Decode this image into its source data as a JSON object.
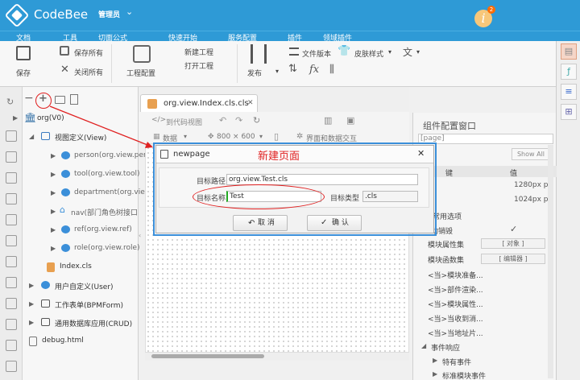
{
  "app": {
    "title": "CodeBee",
    "user": "管理员",
    "badge": "2"
  },
  "menu": [
    "文档",
    "工具",
    "切面公式",
    "快速开始",
    "服务配置",
    "插件",
    "领域插件"
  ],
  "ribbon": {
    "save": "保存",
    "save_all": "保存所有",
    "close_all": "关闭所有",
    "project_config": "工程配置",
    "new_project": "新建工程",
    "open_project": "打开工程",
    "publish": "发布",
    "file_version": "文件版本",
    "skin": "皮肤样式"
  },
  "tree": {
    "root": "org(V0)",
    "view_def": "视图定义(View)",
    "items": [
      "person(org.view.per",
      "tool(org.view.tool)",
      "department(org.vie",
      "nav(部门角色树接口",
      "ref(org.view.ref)",
      "role(org.view.role)"
    ],
    "index_file": "Index.cls",
    "user_def": "用户自定义(User)",
    "bpm_form": "工作表单(BPMForm)",
    "crud": "通用数据库应用(CRUD)",
    "debug": "debug.html"
  },
  "editor": {
    "tab": "org.view.Index.cls.cls",
    "code_view": "到代码视图",
    "data": "数据",
    "size": "800 × 600",
    "interaction": "界面和数据交互"
  },
  "right_panel": {
    "title": "组件配置窗口",
    "search": "[page]",
    "show_all": "Show All",
    "col_key": "键",
    "col_value": "值",
    "width_val": "1280px px",
    "height_val": "1024px px",
    "common_options": "常用选项",
    "mirror": "动销毁",
    "check": "✓",
    "rows": [
      {
        "key": "模块属性集",
        "value": "[ 对象 ]"
      },
      {
        "key": "模块函数集",
        "value": "[ 编辑器 ]"
      },
      {
        "key": "<当>模块准备..."
      },
      {
        "key": "<当>部件渲染..."
      },
      {
        "key": "<当>模块属性..."
      },
      {
        "key": "<当>当收到消..."
      },
      {
        "key": "<当>当地址片..."
      }
    ],
    "events": "事件响应",
    "special_events": "特有事件",
    "std_events": "标准模块事件"
  },
  "dialog": {
    "title": "newpage",
    "annotation": "新建页面",
    "target_path_label": "目标路径",
    "target_path_value": "org.view.Test.cls",
    "target_name_label": "目标名称",
    "target_name_value": "Test",
    "target_type_label": "目标类型",
    "target_type_value": ".cls",
    "cancel": "取 消",
    "confirm": "确 认"
  },
  "colors": {
    "titlebar": "#2e9ad6",
    "annotation_red": "#e02020",
    "dialog_border": "#3b8fd9"
  }
}
